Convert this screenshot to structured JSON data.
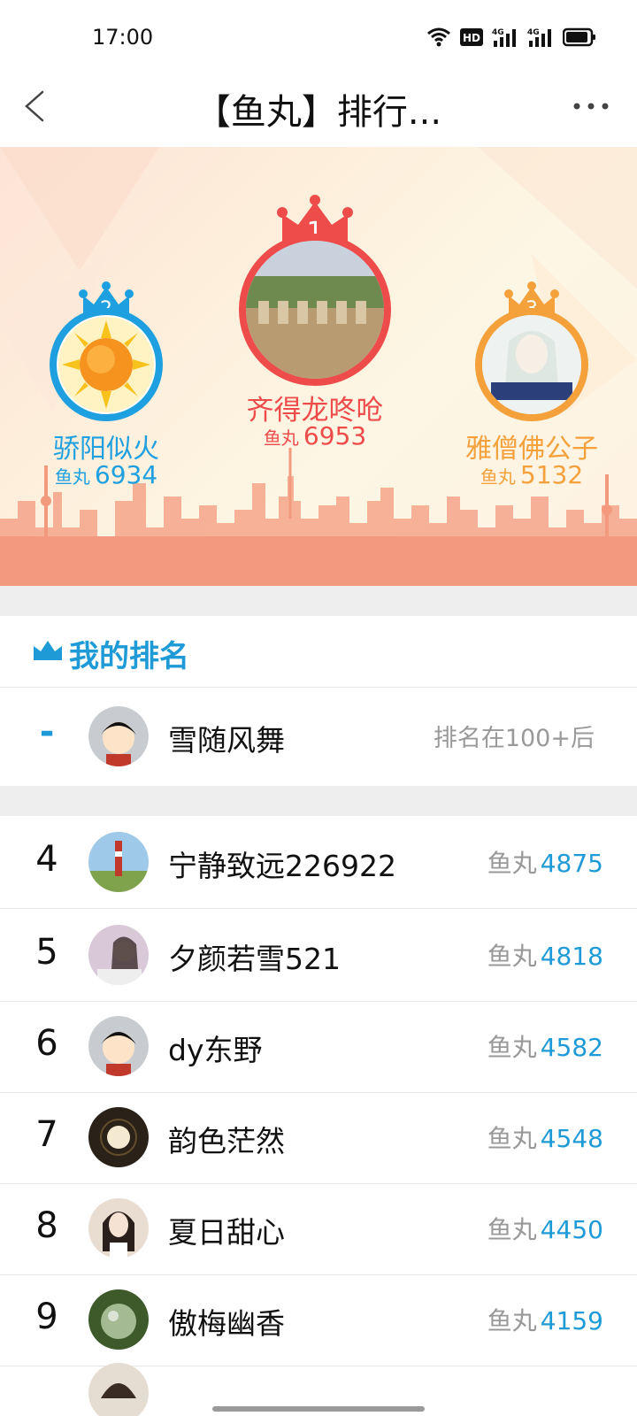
{
  "status_bar": {
    "time": "17:00"
  },
  "header": {
    "title": "【鱼丸】排行..."
  },
  "podium": [
    {
      "rank": "2",
      "name": "骄阳似火",
      "unit": "鱼丸",
      "score": "6934",
      "color": "#1ea0e0"
    },
    {
      "rank": "1",
      "name": "齐得龙咚呛",
      "unit": "鱼丸",
      "score": "6953",
      "color": "#ee4b4b"
    },
    {
      "rank": "3",
      "name": "雅僧佛公子",
      "unit": "鱼丸",
      "score": "5132",
      "color": "#f4a13c"
    }
  ],
  "my_rank": {
    "title": "我的排名",
    "rank": "-",
    "name": "雪随风舞",
    "status": "排名在100+后"
  },
  "list": [
    {
      "rank": "4",
      "name": "宁静致远226922",
      "unit": "鱼丸",
      "score": "4875"
    },
    {
      "rank": "5",
      "name": "夕颜若雪521",
      "unit": "鱼丸",
      "score": "4818"
    },
    {
      "rank": "6",
      "name": "dy东野",
      "unit": "鱼丸",
      "score": "4582"
    },
    {
      "rank": "7",
      "name": "韵色茫然",
      "unit": "鱼丸",
      "score": "4548"
    },
    {
      "rank": "8",
      "name": "夏日甜心",
      "unit": "鱼丸",
      "score": "4450"
    },
    {
      "rank": "9",
      "name": "傲梅幽香",
      "unit": "鱼丸",
      "score": "4159"
    }
  ],
  "colors": {
    "accent": "#1e9bd7",
    "gold": "#f4a13c",
    "red": "#ee4b4b"
  }
}
